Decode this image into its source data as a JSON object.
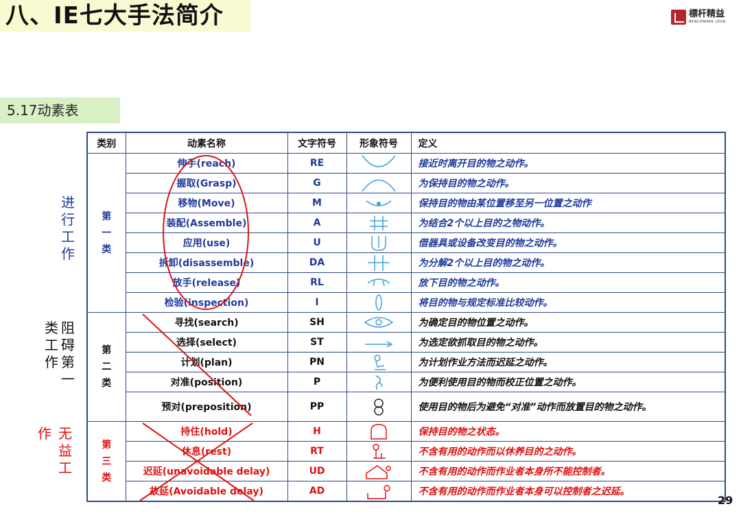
{
  "header": {
    "title": "八、IE七大手法简介",
    "logo_name": "標杆精益",
    "logo_sub": "BENCHMARK LEAN",
    "logo_icon": "benchmark-logo-icon"
  },
  "section": {
    "label": "5.17动素表"
  },
  "side_labels": {
    "group1": [
      "进",
      "行",
      "工",
      "作"
    ],
    "group2_col_a": [
      "阻",
      "碍",
      "第",
      "一"
    ],
    "group2_col_b": [
      "类",
      "工",
      "作"
    ],
    "group3_col_a": [
      "无",
      "益",
      "工"
    ],
    "group3_col_b": [
      "作"
    ]
  },
  "table": {
    "headers": {
      "category": "类别",
      "name": "动素名称",
      "abbr": "文字符号",
      "symbol": "形象符号",
      "definition": "定义"
    },
    "groups": [
      {
        "category": [
          "第",
          "一",
          "类"
        ],
        "rows": [
          {
            "name": "伸手(reach)",
            "abbr": "RE",
            "symbol_icon": "reach-symbol-icon",
            "definition": "接近时离开目的物之动作。"
          },
          {
            "name": "握取(Grasp)",
            "abbr": "G",
            "symbol_icon": "grasp-symbol-icon",
            "definition": "为保持目的物之动作。"
          },
          {
            "name": "移物(Move)",
            "abbr": "M",
            "symbol_icon": "move-symbol-icon",
            "definition": "保持目的物由某位置移至另一位置之动作"
          },
          {
            "name": "装配(Assemble)",
            "abbr": "A",
            "symbol_icon": "assemble-symbol-icon",
            "definition": "为结合2个以上目的之物动作。"
          },
          {
            "name": "应用(use)",
            "abbr": "U",
            "symbol_icon": "use-symbol-icon",
            "definition": "借器具或设备改变目的物之动作。"
          },
          {
            "name": "拆卸(disassemble)",
            "abbr": "DA",
            "symbol_icon": "disassemble-symbol-icon",
            "definition": "为分解2个以上目的物之动作。"
          },
          {
            "name": "放手(release)",
            "abbr": "RL",
            "symbol_icon": "release-symbol-icon",
            "definition": "放下目的物之动作。"
          },
          {
            "name": "检验(inspection)",
            "abbr": "I",
            "symbol_icon": "inspection-symbol-icon",
            "definition": "将目的物与规定标准比较动作。"
          }
        ]
      },
      {
        "category": [
          "第",
          "二",
          "类"
        ],
        "rows": [
          {
            "name": "寻找(search)",
            "abbr": "SH",
            "symbol_icon": "search-symbol-icon",
            "definition": "为确定目的物位置之动作。"
          },
          {
            "name": "选择(select)",
            "abbr": "ST",
            "symbol_icon": "select-symbol-icon",
            "definition": "为选定欲抓取目的物之动作。"
          },
          {
            "name": "计划(plan)",
            "abbr": "PN",
            "symbol_icon": "plan-symbol-icon",
            "definition": "为计划作业方法而迟延之动作。"
          },
          {
            "name": "对准(position)",
            "abbr": "P",
            "symbol_icon": "position-symbol-icon",
            "definition": "为便利使用目的物而校正位置之动作。"
          },
          {
            "name": "预对(preposition)",
            "abbr": "PP",
            "symbol_icon": "preposition-symbol-icon",
            "definition": "使用目的物后为避免“对准”动作而放置目的物之动作。"
          }
        ]
      },
      {
        "category": [
          "第",
          "三",
          "类"
        ],
        "rows": [
          {
            "name": "持住(hold)",
            "abbr": "H",
            "symbol_icon": "hold-symbol-icon",
            "definition": "保持目的物之状态。"
          },
          {
            "name": "休息(rest)",
            "abbr": "RT",
            "symbol_icon": "rest-symbol-icon",
            "definition": "不含有用的动作而以休养目的之动作。"
          },
          {
            "name": "迟延(unavoidable delay)",
            "abbr": "UD",
            "symbol_icon": "unavoidable-delay-symbol-icon",
            "definition": "不含有用的动作而作业者本身所不能控制者。"
          },
          {
            "name": "故延(Avoidable delay)",
            "abbr": "AD",
            "symbol_icon": "avoidable-delay-symbol-icon",
            "definition": "不含有用的动作而作业者本身可以控制者之迟延。"
          }
        ]
      }
    ]
  },
  "colors": {
    "group1": "#1f3a9c",
    "group2": "#111111",
    "group3": "#e01010",
    "symbol": "#3f9fd9",
    "mark": "#e01010",
    "title_band": "#fafad2",
    "section_band": "#d8f0c4"
  },
  "page_number": "29"
}
